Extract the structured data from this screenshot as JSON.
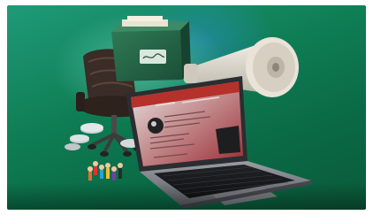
{
  "scene": {
    "description_free": true,
    "objects": [
      "desk-chair",
      "green-storage-box",
      "megaphone",
      "laptop",
      "toy-figures"
    ]
  },
  "colors": {
    "background_top": "#1f9a78",
    "background_bottom": "#0b5a3a",
    "screen_header": "#b5312c"
  }
}
